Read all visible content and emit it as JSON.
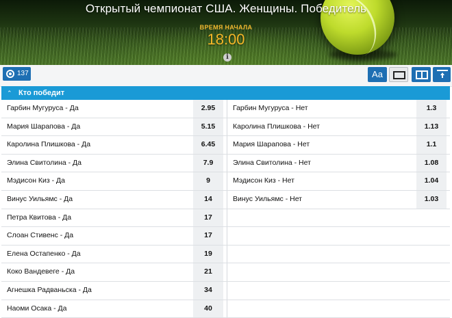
{
  "header": {
    "title": "Открытый чемпионат США. Женщины. Победитель",
    "start_label": "ВРЕМЯ НАЧАЛА",
    "start_time": "18:00"
  },
  "toolbar": {
    "markets_count": "137",
    "font_button": "Aa",
    "icons": [
      "target-icon",
      "font-size-icon",
      "one-column-icon",
      "two-column-icon",
      "scroll-top-icon"
    ]
  },
  "market": {
    "title": "Кто победит",
    "rows": [
      {
        "left": {
          "name": "Гарбин Мугуруса - Да",
          "odds": "2.95"
        },
        "right": {
          "name": "Гарбин Мугуруса - Нет",
          "odds": "1.3"
        }
      },
      {
        "left": {
          "name": "Мария Шарапова - Да",
          "odds": "5.15"
        },
        "right": {
          "name": "Каролина Плишкова - Нет",
          "odds": "1.13"
        }
      },
      {
        "left": {
          "name": "Каролина Плишкова - Да",
          "odds": "6.45"
        },
        "right": {
          "name": "Мария Шарапова - Нет",
          "odds": "1.1"
        }
      },
      {
        "left": {
          "name": "Элина Свитолина - Да",
          "odds": "7.9"
        },
        "right": {
          "name": "Элина Свитолина - Нет",
          "odds": "1.08"
        }
      },
      {
        "left": {
          "name": "Мэдисон Киз - Да",
          "odds": "9"
        },
        "right": {
          "name": "Мэдисон Киз - Нет",
          "odds": "1.04"
        }
      },
      {
        "left": {
          "name": "Винус Уильямс - Да",
          "odds": "14"
        },
        "right": {
          "name": "Винус Уильямс - Нет",
          "odds": "1.03"
        }
      },
      {
        "left": {
          "name": "Петра Квитова - Да",
          "odds": "17"
        },
        "right": null
      },
      {
        "left": {
          "name": "Слоан Стивенс - Да",
          "odds": "17"
        },
        "right": null
      },
      {
        "left": {
          "name": "Елена Остапенко - Да",
          "odds": "19"
        },
        "right": null
      },
      {
        "left": {
          "name": "Коко Вандевеге - Да",
          "odds": "21"
        },
        "right": null
      },
      {
        "left": {
          "name": "Агнешка Радваньска - Да",
          "odds": "34"
        },
        "right": null
      },
      {
        "left": {
          "name": "Наоми Осака - Да",
          "odds": "40"
        },
        "right": null
      }
    ]
  },
  "colors": {
    "accent_blue": "#1a9ad6",
    "button_blue": "#1e6fb3",
    "time_orange": "#f5b728"
  }
}
